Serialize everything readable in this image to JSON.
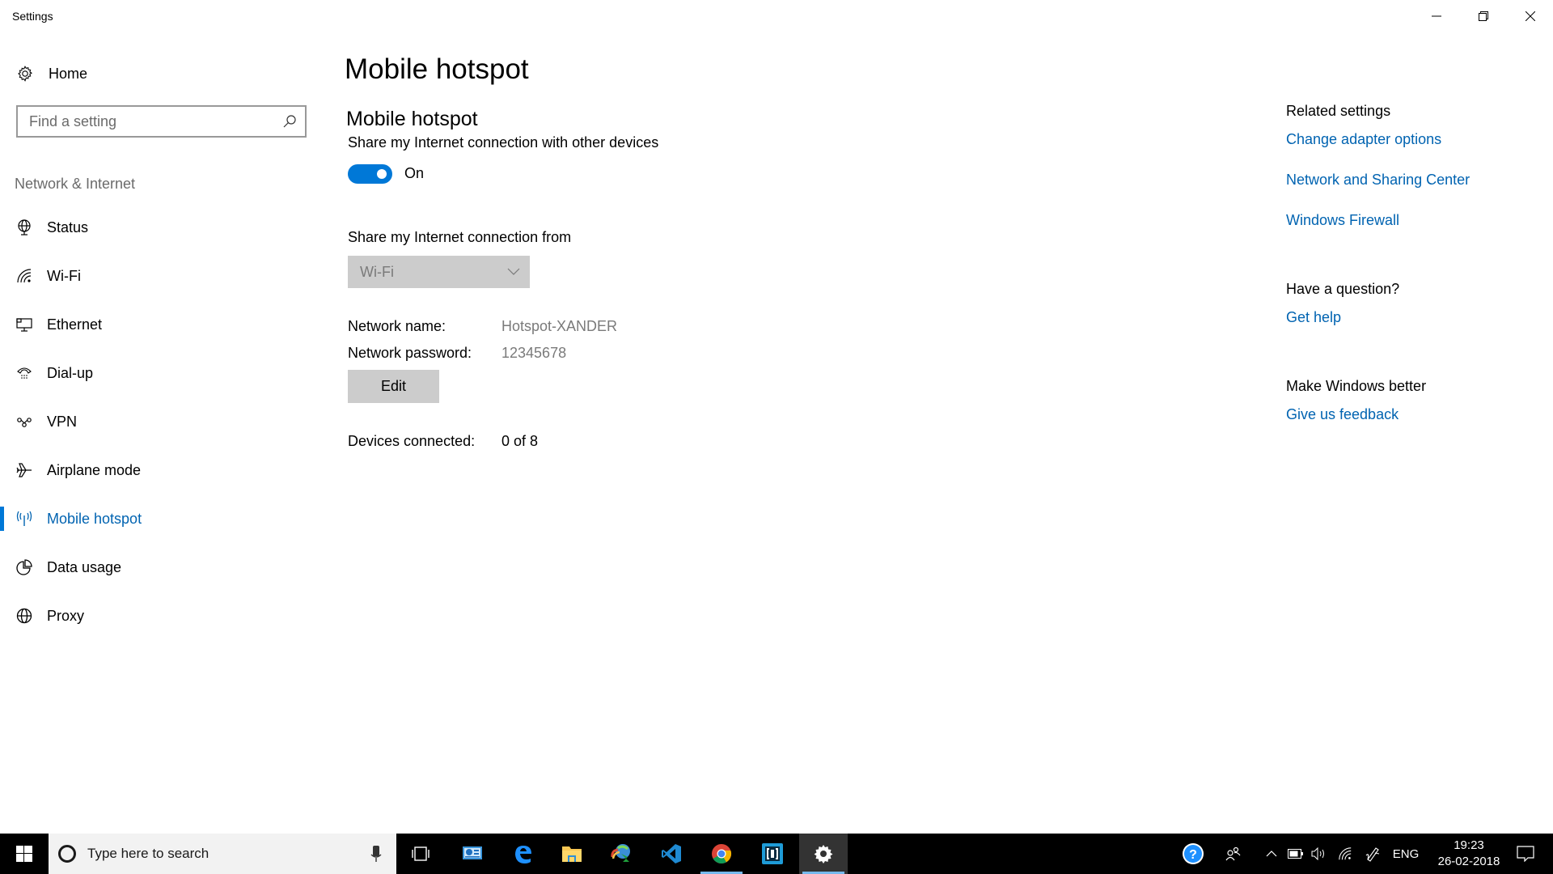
{
  "window": {
    "title": "Settings",
    "controls": {
      "minimize": "minimize-icon",
      "restore": "restore-icon",
      "close": "close-icon"
    }
  },
  "sidebar": {
    "home_label": "Home",
    "search_placeholder": "Find a setting",
    "section_title": "Network & Internet",
    "items": [
      {
        "label": "Status",
        "icon": "status-globe-icon"
      },
      {
        "label": "Wi-Fi",
        "icon": "wifi-icon"
      },
      {
        "label": "Ethernet",
        "icon": "ethernet-icon"
      },
      {
        "label": "Dial-up",
        "icon": "dialup-icon"
      },
      {
        "label": "VPN",
        "icon": "vpn-icon"
      },
      {
        "label": "Airplane mode",
        "icon": "airplane-icon"
      },
      {
        "label": "Mobile hotspot",
        "icon": "hotspot-icon",
        "active": true
      },
      {
        "label": "Data usage",
        "icon": "data-usage-icon"
      },
      {
        "label": "Proxy",
        "icon": "proxy-globe-icon"
      }
    ]
  },
  "main": {
    "page_title": "Mobile hotspot",
    "section_title": "Mobile hotspot",
    "share_description": "Share my Internet connection with other devices",
    "toggle": {
      "state": true,
      "label": "On"
    },
    "share_from_label": "Share my Internet connection from",
    "share_from_value": "Wi-Fi",
    "network_name_label": "Network name:",
    "network_name_value": "Hotspot-XANDER",
    "network_password_label": "Network password:",
    "network_password_value": "12345678",
    "edit_label": "Edit",
    "devices_connected_label": "Devices connected:",
    "devices_connected_value": "0 of 8"
  },
  "related": {
    "heading": "Related settings",
    "links": [
      "Change adapter options",
      "Network and Sharing Center",
      "Windows Firewall"
    ],
    "question_heading": "Have a question?",
    "help_link": "Get help",
    "better_heading": "Make Windows better",
    "feedback_link": "Give us feedback"
  },
  "taskbar": {
    "search_placeholder": "Type here to search",
    "apps": [
      "task-view",
      "control-panel",
      "edge",
      "file-explorer",
      "internet-download-manager",
      "vs-code",
      "chrome",
      "brackets",
      "settings"
    ],
    "tray": {
      "language": "ENG",
      "time": "19:23",
      "date": "26-02-2018"
    }
  },
  "colors": {
    "accent": "#0078d7",
    "link": "#0063b1",
    "disabled_bg": "#cccccc"
  }
}
